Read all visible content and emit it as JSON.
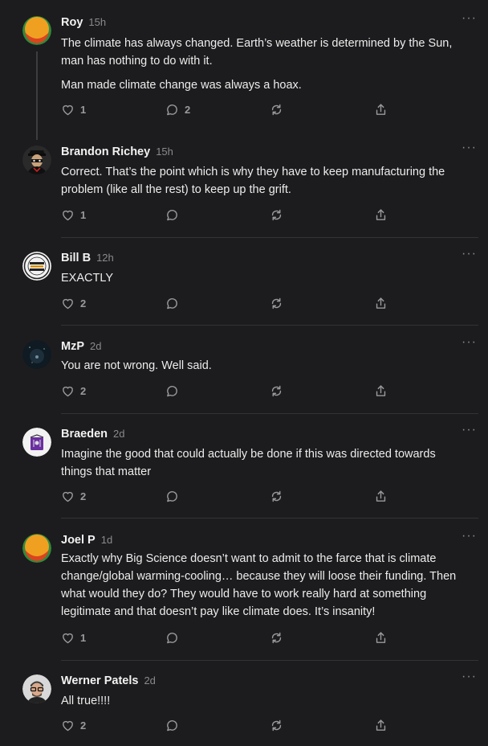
{
  "comments": [
    {
      "author": "Roy",
      "time": "15h",
      "paragraphs": [
        "The climate has always changed. Earth’s weather is determined by the Sun,",
        "man has nothing to do with it.",
        "Man made climate change was always a hoax."
      ],
      "likes": "1",
      "replies": "2",
      "more": "···"
    },
    {
      "author": "Brandon Richey",
      "time": "15h",
      "paragraphs": [
        "Correct. That’s the point which is why they have to keep manufacturing the",
        "problem (like all the rest) to keep up the grift."
      ],
      "likes": "1",
      "replies": "",
      "more": "···"
    },
    {
      "author": "Bill B",
      "time": "12h",
      "paragraphs": [
        "EXACTLY"
      ],
      "likes": "2",
      "replies": "",
      "more": "···"
    },
    {
      "author": "MzP",
      "time": "2d",
      "paragraphs": [
        "You are not wrong. Well said."
      ],
      "likes": "2",
      "replies": "",
      "more": "···"
    },
    {
      "author": "Braeden",
      "time": "2d",
      "paragraphs": [
        "Imagine the good that could actually be done if this was directed towards",
        "things that matter"
      ],
      "likes": "2",
      "replies": "",
      "more": "···"
    },
    {
      "author": "Joel P",
      "time": "1d",
      "paragraphs": [
        "Exactly why Big Science doesn’t want to admit to the farce that is climate",
        "change/global warming-cooling… because they will loose their funding. Then",
        "what would they do? They would have to work really hard at something",
        "legitimate and that doesn’t pay like climate does. It’s insanity!"
      ],
      "likes": "1",
      "replies": "",
      "more": "···"
    },
    {
      "author": "Werner Patels",
      "time": "2d",
      "paragraphs": [
        "All true!!!!"
      ],
      "likes": "2",
      "replies": "",
      "more": "···"
    }
  ],
  "avatar_icons": [
    "orange-green-circle-avatar",
    "masked-figure-avatar",
    "vietnam-veteran-badge-avatar",
    "night-sky-avatar",
    "purple-book-avatar",
    "orange-green-circle-avatar",
    "man-with-glasses-avatar"
  ],
  "icons": {
    "like": "heart-icon",
    "reply": "speech-bubble-icon",
    "restack": "restack-arrows-icon",
    "share": "share-upload-icon",
    "more": "ellipsis-icon"
  },
  "colors": {
    "background": "#1c1c1e",
    "text": "#ececec",
    "muted": "#8a8a8e",
    "divider": "#333336"
  }
}
